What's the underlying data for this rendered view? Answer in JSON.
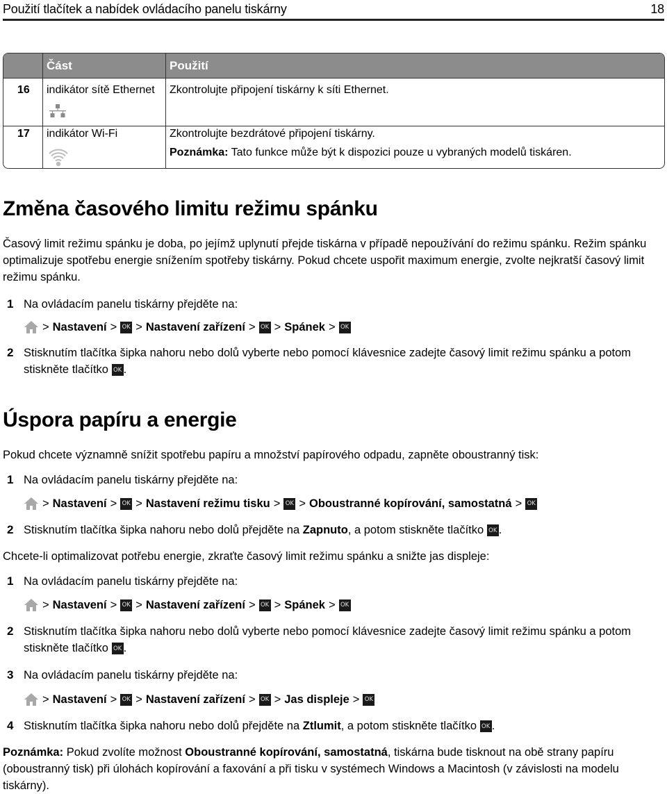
{
  "header": {
    "title": "Použití tlačítek a nabídek ovládacího panelu tiskárny",
    "page_number": "18"
  },
  "table": {
    "columns": [
      "",
      "Část",
      "Použití"
    ],
    "rows": [
      {
        "number": "16",
        "part": "indikátor sítě Ethernet",
        "icon": "ethernet-network-icon",
        "usage": "Zkontrolujte připojení tiskárny k síti Ethernet.",
        "note_label": "",
        "note_text": ""
      },
      {
        "number": "17",
        "part": "indikátor Wi-Fi",
        "icon": "wifi-icon",
        "usage": "Zkontrolujte bezdrátové připojení tiskárny.",
        "note_label": "Poznámka:",
        "note_text": " Tato funkce může být k dispozici pouze u vybraných modelů tiskáren."
      }
    ]
  },
  "section1": {
    "title": "Změna časového limitu režimu spánku",
    "intro": "Časový limit režimu spánku je doba, po jejímž uplynutí přejde tiskárna v případě nepoužívání do režimu spánku. Režim spánku optimalizuje spotřebu energie snížením spotřeby tiskárny. Pokud chcete uspořit maximum energie, zvolte nejkratší časový limit režimu spánku.",
    "steps": [
      {
        "n": "1",
        "text": "Na ovládacím panelu tiskárny přejděte na:"
      },
      {
        "n": "2",
        "text": "Stisknutím tlačítka šipka nahoru nebo dolů vyberte nebo pomocí klávesnice zadejte časový limit režimu spánku a potom stiskněte tlačítko"
      }
    ],
    "path": [
      "Nastavení",
      "Nastavení zařízení",
      "Spánek"
    ]
  },
  "section2": {
    "title": "Úspora papíru a energie",
    "intro": "Pokud chcete významně snížit spotřebu papíru a množství papírového odpadu, zapněte oboustranný tisk:",
    "steps_a": [
      {
        "n": "1",
        "text": "Na ovládacím panelu tiskárny přejděte na:"
      },
      {
        "n": "2",
        "text_before": "Stisknutím tlačítka šipka nahoru nebo dolů přejděte na ",
        "bold": "Zapnuto",
        "text_after": ", a potom stiskněte tlačítko"
      }
    ],
    "path_a": [
      "Nastavení",
      "Nastavení režimu tisku",
      "Oboustranné kopírování, samostatná"
    ],
    "intro2": "Chcete-li optimalizovat potřebu energie, zkraťte časový limit režimu spánku a snižte jas displeje:",
    "steps_b": [
      {
        "n": "1",
        "text": "Na ovládacím panelu tiskárny přejděte na:"
      },
      {
        "n": "2",
        "text": "Stisknutím tlačítka šipka nahoru nebo dolů vyberte nebo pomocí klávesnice zadejte časový limit režimu spánku a potom stiskněte tlačítko"
      },
      {
        "n": "3",
        "text": "Na ovládacím panelu tiskárny přejděte na:"
      },
      {
        "n": "4",
        "text_before": "Stisknutím tlačítka šipka nahoru nebo dolů přejděte na ",
        "bold": "Ztlumit",
        "text_after": ", a potom stiskněte tlačítko"
      }
    ],
    "path_b1": [
      "Nastavení",
      "Nastavení zařízení",
      "Spánek"
    ],
    "path_b2": [
      "Nastavení",
      "Nastavení zařízení",
      "Jas displeje"
    ],
    "note_label": "Poznámka:",
    "note_before": " Pokud zvolíte možnost ",
    "note_bold": "Oboustranné kopírování, samostatná",
    "note_after": ", tiskárna bude tisknout na obě strany papíru (oboustranný tisk) při úlohách kopírování a faxování a při tisku v systémech Windows a Macintosh (v závislosti na modelu tiskárny)."
  },
  "symbols": {
    "separator": ">",
    "ok_label": "OK",
    "period": "."
  },
  "colors": {
    "table_header_bg": "#8c8c8c",
    "ok_button_bg": "#1a1a1a",
    "icon_gray": "#9a9a9a"
  }
}
